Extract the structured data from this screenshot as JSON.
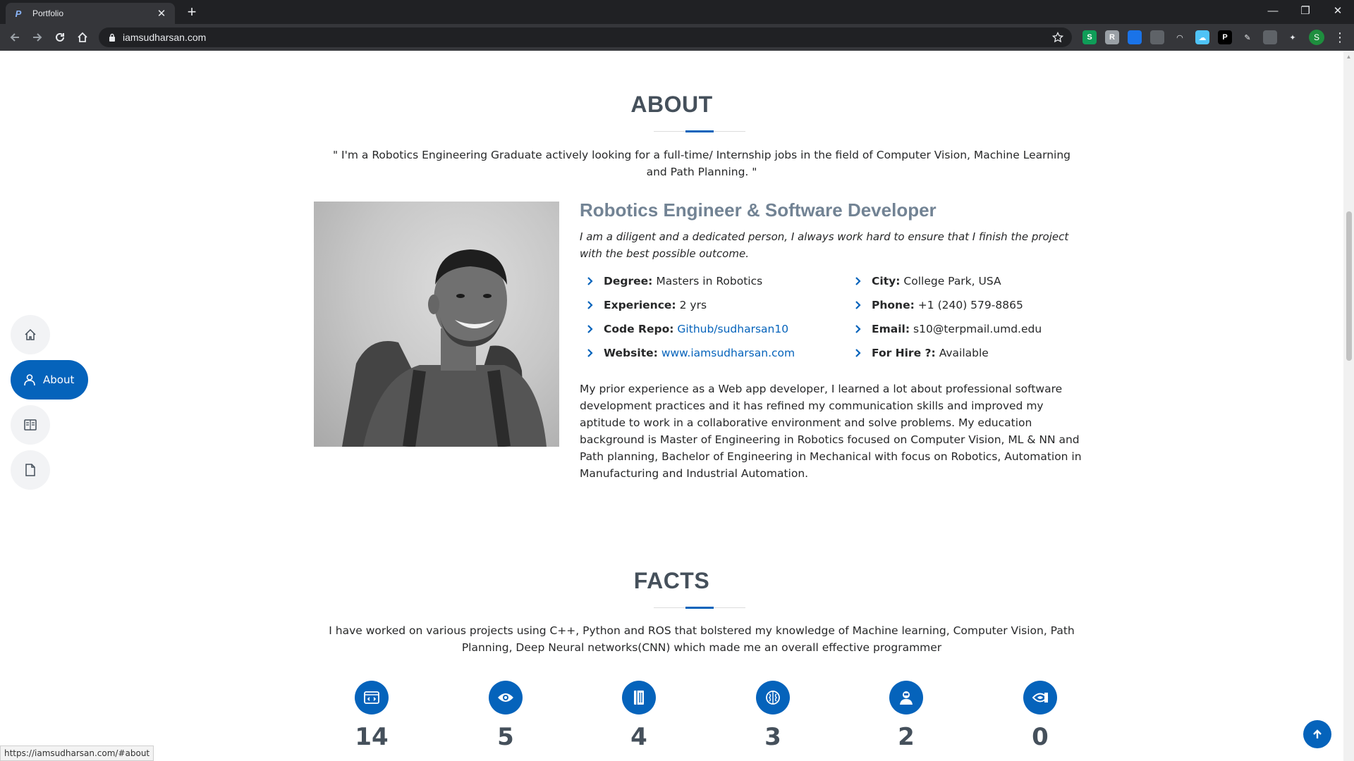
{
  "browser": {
    "tab_title": "Portfolio",
    "tab_favicon": "P",
    "url": "iamsudharsan.com",
    "status_url": "https://iamsudharsan.com/#about",
    "profile_initial": "S",
    "extension_letters": [
      "S",
      "R",
      "",
      "",
      "",
      "",
      "P",
      "",
      "",
      ""
    ]
  },
  "about": {
    "title": "ABOUT",
    "quote": "\" I'm a Robotics Engineering Graduate actively looking for a full-time/ Internship jobs in the field of Computer Vision, Machine Learning and Path Planning. \"",
    "role": "Robotics Engineer & Software Developer",
    "tagline": "I am a diligent and a dedicated person, I always work hard to ensure that I finish the project with the best possible outcome.",
    "info_left": [
      {
        "label": "Degree:",
        "value": "Masters in Robotics"
      },
      {
        "label": "Experience:",
        "value": "2 yrs"
      },
      {
        "label": "Code Repo:",
        "value": "Github/sudharsan10"
      },
      {
        "label": "Website:",
        "value": "www.iamsudharsan.com"
      }
    ],
    "info_right": [
      {
        "label": "City:",
        "value": "College Park, USA"
      },
      {
        "label": "Phone:",
        "value": "+1 (240) 579-8865"
      },
      {
        "label": "Email:",
        "value": "s10@terpmail.umd.edu"
      },
      {
        "label": "For Hire ?:",
        "value": "Available"
      }
    ],
    "body": "My prior experience as a Web app developer, I learned a lot about professional software development practices and it has refined my communication skills and improved my aptitude to work in a collaborative environment and solve problems. My education background is Master of Engineering in Robotics focused on Computer Vision, ML & NN and Path planning, Bachelor of Engineering in Mechanical with focus on Robotics, Automation in Manufacturing and Industrial Automation."
  },
  "facts": {
    "title": "FACTS",
    "description": "I have worked on various projects using C++, Python and ROS that bolstered my knowledge of Machine learning, Computer Vision, Path Planning, Deep Neural networks(CNN) which made me an overall effective programmer",
    "items": [
      {
        "icon": "code-window-icon",
        "number": "14"
      },
      {
        "icon": "eye-icon",
        "number": "5"
      },
      {
        "icon": "notebook-icon",
        "number": "4"
      },
      {
        "icon": "brain-icon",
        "number": "3"
      },
      {
        "icon": "robot-user-icon",
        "number": "2"
      },
      {
        "icon": "nvidia-icon",
        "number": "0"
      }
    ]
  },
  "nav": {
    "about_label": "About"
  },
  "colors": {
    "accent": "#0563bb",
    "heading": "#45505b",
    "role": "#728394"
  }
}
